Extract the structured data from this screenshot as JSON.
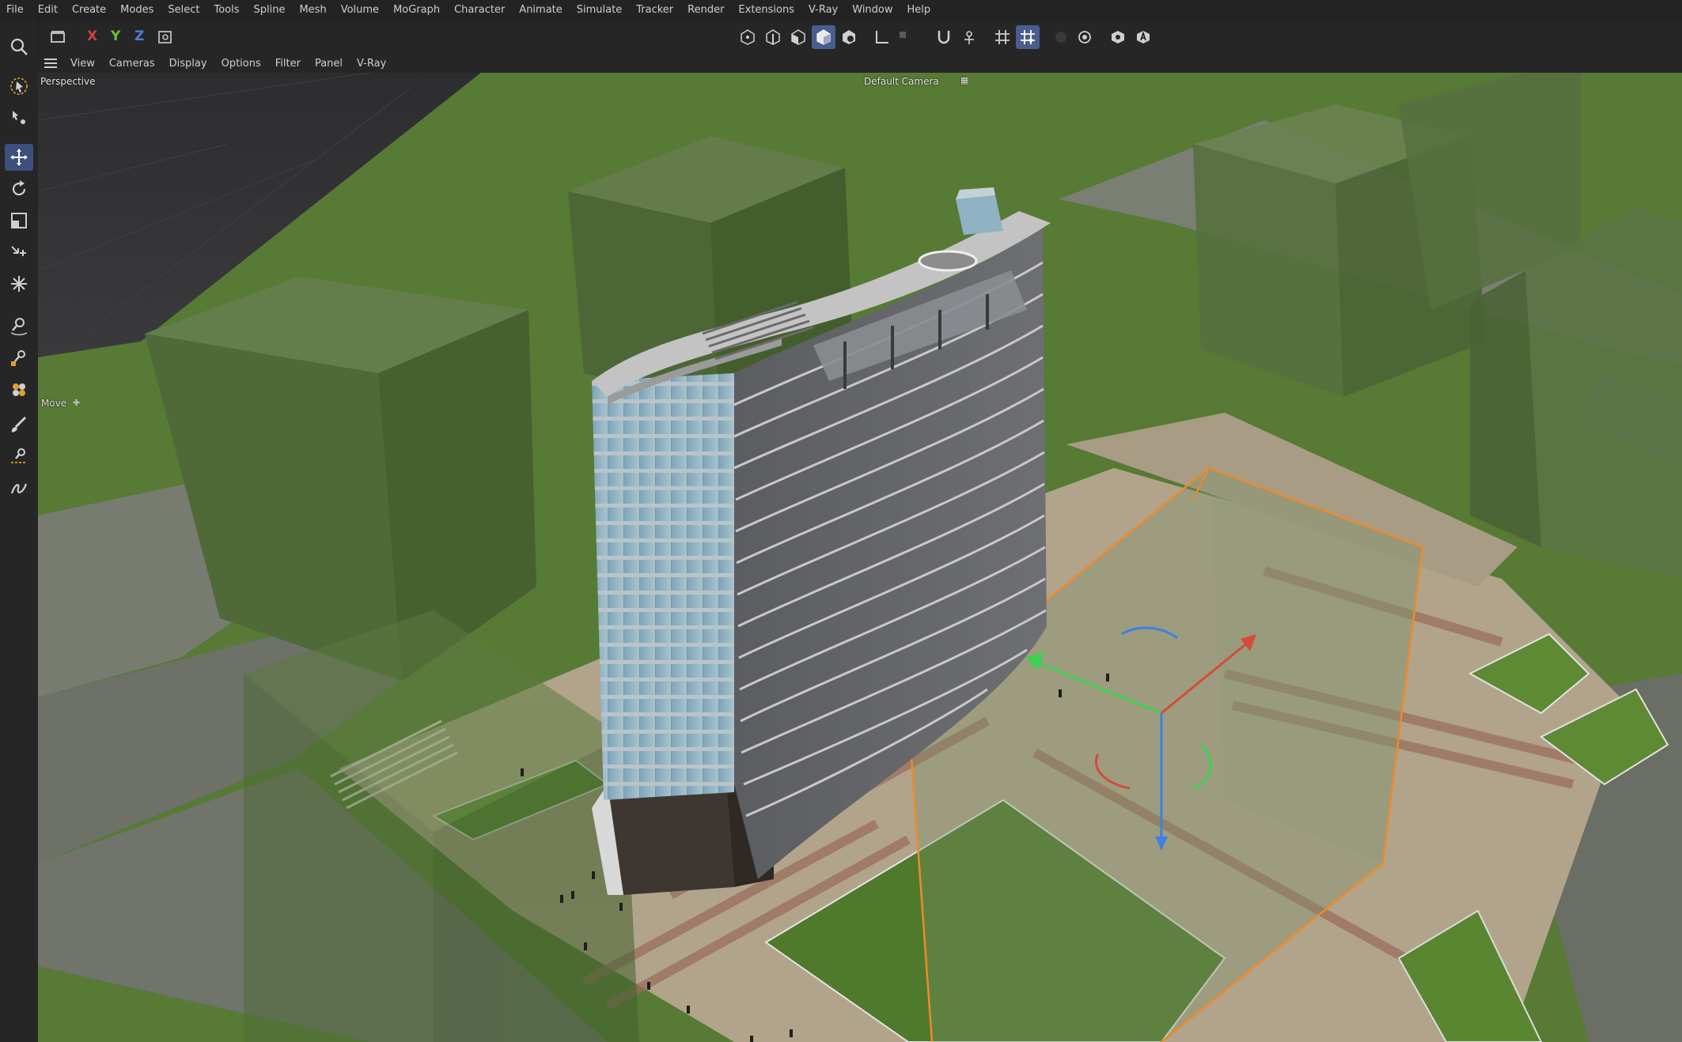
{
  "menu": [
    "File",
    "Edit",
    "Create",
    "Modes",
    "Select",
    "Tools",
    "Spline",
    "Mesh",
    "Volume",
    "MoGraph",
    "Character",
    "Animate",
    "Simulate",
    "Tracker",
    "Render",
    "Extensions",
    "V-Ray",
    "Window",
    "Help"
  ],
  "toolbar": {
    "axis_x": "X",
    "axis_y": "Y",
    "axis_z": "Z",
    "colors": {
      "x": "#d2423c",
      "y": "#6abf3b",
      "z": "#4a7fd6",
      "active": "#4a5d8f"
    }
  },
  "viewport_menu": [
    "View",
    "Cameras",
    "Display",
    "Options",
    "Filter",
    "Panel",
    "V-Ray"
  ],
  "viewport": {
    "projection": "Perspective",
    "camera": "Default Camera",
    "active_tool": "Move"
  },
  "icons": {
    "left": [
      "search-icon",
      "live-select-icon",
      "tweak-icon",
      "move-icon",
      "rotate-icon",
      "scale-icon",
      "transfer-icon",
      "extrude-icon",
      "knife-icon",
      "magnet-icon",
      "sculpt-icon",
      "paint-icon",
      "spline-pen-icon",
      "sketch-icon"
    ]
  }
}
